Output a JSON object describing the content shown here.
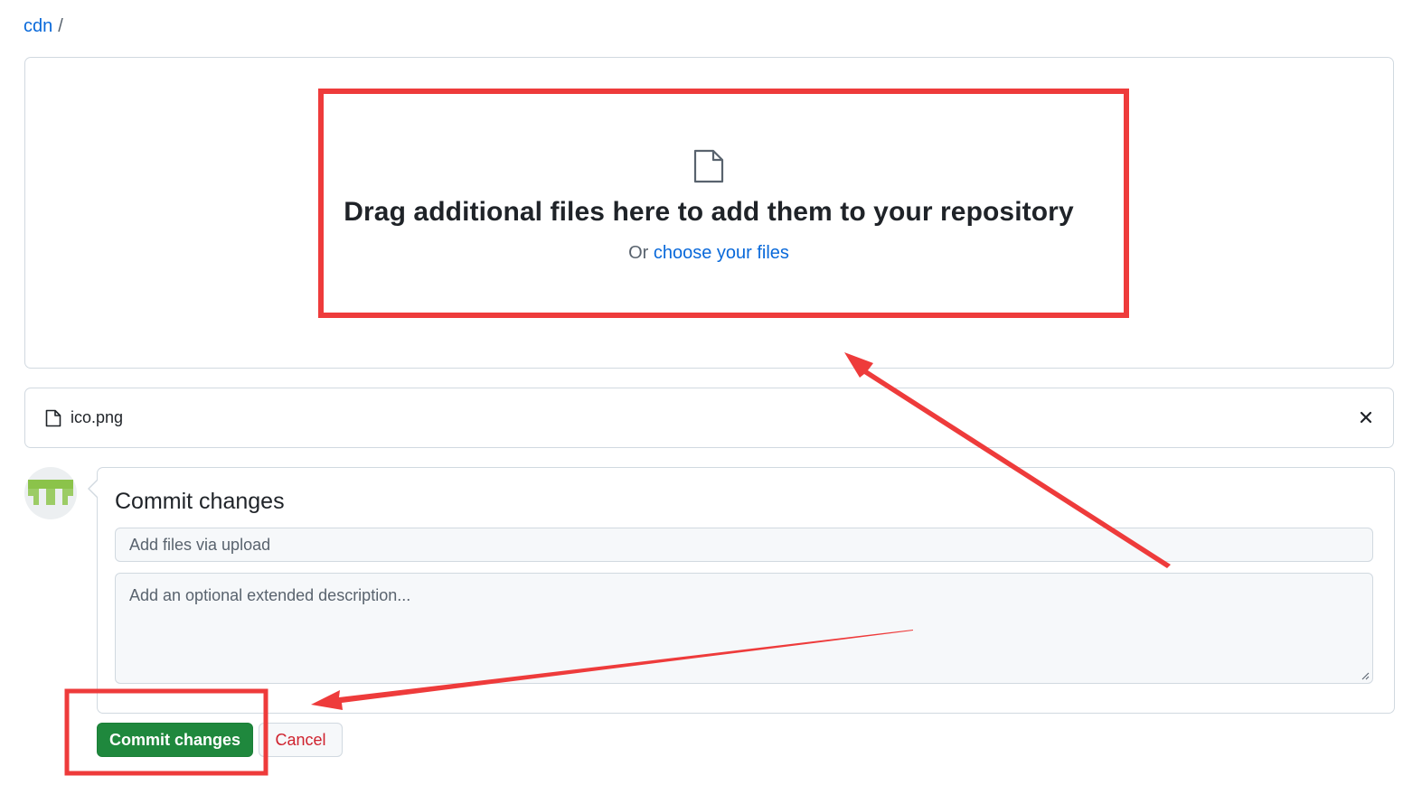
{
  "breadcrumb": {
    "repo": "cdn",
    "separator": "/"
  },
  "dropzone": {
    "icon": "file-icon",
    "title": "Drag additional files here to add them to your repository",
    "prefix": "Or ",
    "link": "choose your files"
  },
  "files": [
    {
      "name": "ico.png",
      "icon": "file-icon",
      "remove_icon": "x-icon"
    }
  ],
  "commit": {
    "title": "Commit changes",
    "summary_placeholder": "Add files via upload",
    "description_placeholder": "Add an optional extended description...",
    "commit_button": "Commit changes",
    "cancel_button": "Cancel"
  },
  "colors": {
    "link": "#0969da",
    "primary_button": "#1f883d",
    "cancel_text": "#cf222e",
    "annotation": "#ee3b3b",
    "avatar": "#9ccc65"
  }
}
